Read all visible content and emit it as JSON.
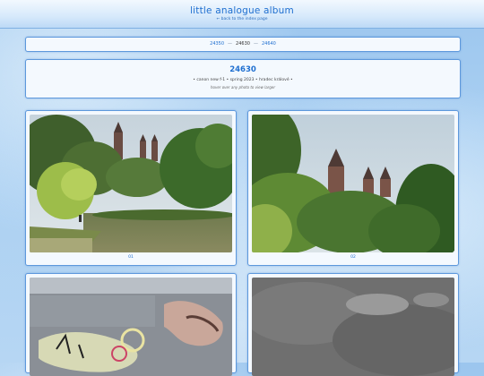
{
  "header": {
    "title": "little analogue album",
    "back": "← back to the index page"
  },
  "nav": {
    "prev": "24350",
    "current": "24630",
    "next": "24640",
    "sep": "—"
  },
  "roll": {
    "title": "24630",
    "meta": "• canon new f-1 • spring 2023 • hradec králové •",
    "hint": "hover over any photo to view larger"
  },
  "photos": [
    {
      "label": "01"
    },
    {
      "label": "02"
    },
    {
      "label": ""
    },
    {
      "label": ""
    }
  ],
  "colors": {
    "accent": "#1f6fd0",
    "border": "#5d98dc"
  }
}
